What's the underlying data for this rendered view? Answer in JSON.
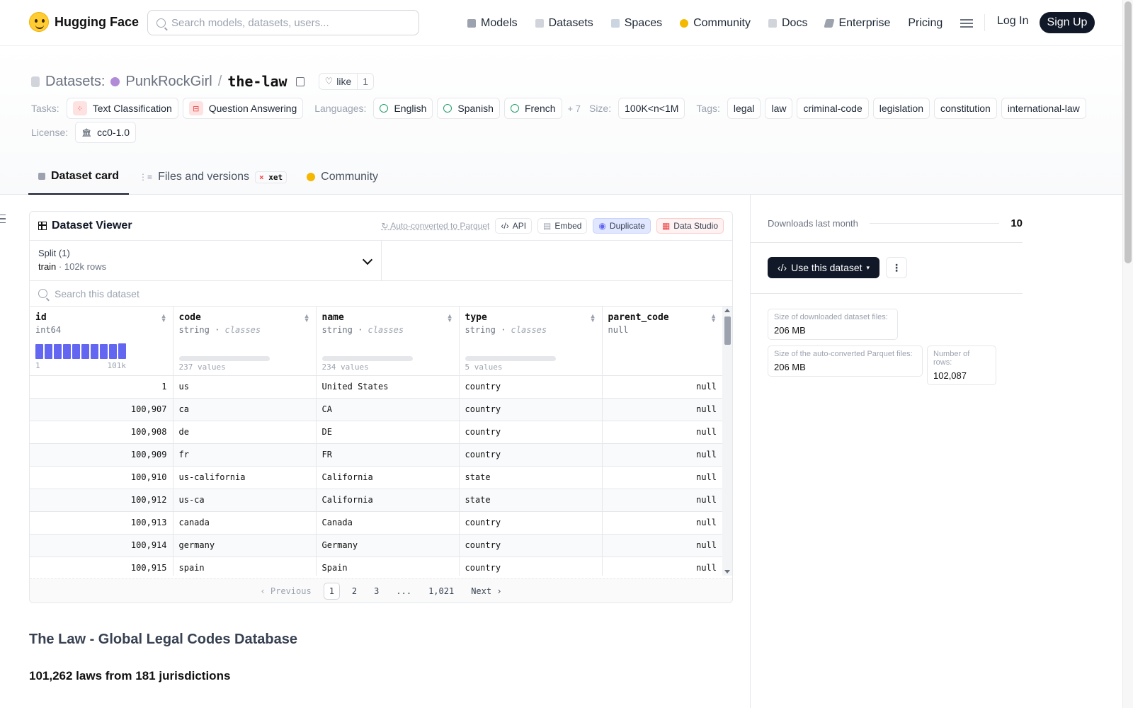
{
  "nav": {
    "brand": "Hugging Face",
    "search_placeholder": "Search models, datasets, users...",
    "items": [
      {
        "label": "Models",
        "icon": "models-icon",
        "color": "#6b7280"
      },
      {
        "label": "Datasets",
        "icon": "datasets-icon",
        "color": "#9ca3af"
      },
      {
        "label": "Spaces",
        "icon": "spaces-icon",
        "color": "#9ca3af"
      },
      {
        "label": "Community",
        "icon": "community-icon",
        "color": "#f5b800"
      },
      {
        "label": "Docs",
        "icon": "docs-icon",
        "color": "#9ca3af"
      },
      {
        "label": "Enterprise",
        "icon": "enterprise-icon",
        "color": "#6b7280"
      },
      {
        "label": "Pricing",
        "icon": "",
        "color": ""
      }
    ],
    "login": "Log In",
    "signup": "Sign Up"
  },
  "dataset": {
    "label": "Datasets:",
    "owner": "PunkRockGirl",
    "name": "the-law",
    "like_label": "like",
    "like_count": "1"
  },
  "meta": {
    "tasks_label": "Tasks:",
    "tasks": [
      "Text Classification",
      "Question Answering"
    ],
    "languages_label": "Languages:",
    "languages": [
      "English",
      "Spanish",
      "French"
    ],
    "languages_more": "+ 7",
    "size_label": "Size:",
    "size": "100K<n<1M",
    "tags_label": "Tags:",
    "tags": [
      "legal",
      "law",
      "criminal-code",
      "legislation",
      "constitution",
      "international-law"
    ],
    "license_label": "License:",
    "license": "cc0-1.0"
  },
  "tabs": {
    "card": "Dataset card",
    "files": "Files and versions",
    "xet": "xet",
    "community": "Community"
  },
  "viewer": {
    "title": "Dataset Viewer",
    "auto_converted": "Auto-converted to Parquet",
    "api": "API",
    "embed": "Embed",
    "duplicate": "Duplicate",
    "data_studio": "Data Studio",
    "split_label": "Split (1)",
    "split_name": "train",
    "split_rows": "102k rows",
    "search_placeholder": "Search this dataset",
    "columns": [
      {
        "name": "id",
        "type": "int64",
        "kind": "hist",
        "min": "1",
        "max": "101k",
        "hist": [
          1,
          1,
          1,
          1,
          1,
          1,
          1,
          1,
          1,
          1.05
        ]
      },
      {
        "name": "code",
        "type": "string",
        "classes": "classes",
        "kind": "classes",
        "summary": "237 values"
      },
      {
        "name": "name",
        "type": "string",
        "classes": "classes",
        "kind": "classes",
        "summary": "234 values"
      },
      {
        "name": "type",
        "type": "string",
        "classes": "classes",
        "kind": "classes",
        "summary": "5 values"
      },
      {
        "name": "parent_code",
        "type": "null",
        "kind": "null"
      }
    ],
    "rows": [
      [
        "1",
        "us",
        "United States",
        "country",
        "null"
      ],
      [
        "100,907",
        "ca",
        "CA",
        "country",
        "null"
      ],
      [
        "100,908",
        "de",
        "DE",
        "country",
        "null"
      ],
      [
        "100,909",
        "fr",
        "FR",
        "country",
        "null"
      ],
      [
        "100,910",
        "us-california",
        "California",
        "state",
        "null"
      ],
      [
        "100,912",
        "us-ca",
        "California",
        "state",
        "null"
      ],
      [
        "100,913",
        "canada",
        "Canada",
        "country",
        "null"
      ],
      [
        "100,914",
        "germany",
        "Germany",
        "country",
        "null"
      ],
      [
        "100,915",
        "spain",
        "Spain",
        "country",
        "null"
      ]
    ],
    "pager": {
      "previous": "Previous",
      "pages": [
        "1",
        "2",
        "3",
        "...",
        "1,021"
      ],
      "next": "Next"
    }
  },
  "card": {
    "h1": "The Law - Global Legal Codes Database",
    "h2": "101,262 laws from 181 jurisdictions"
  },
  "side": {
    "downloads_label": "Downloads last month",
    "downloads": "10",
    "use_button": "Use this dataset",
    "stats": [
      {
        "label": "Size of downloaded dataset files:",
        "value": "206 MB"
      },
      {
        "label": "Size of the auto-converted Parquet files:",
        "value": "206 MB"
      },
      {
        "label": "Number of rows:",
        "value": "102,087"
      }
    ]
  }
}
